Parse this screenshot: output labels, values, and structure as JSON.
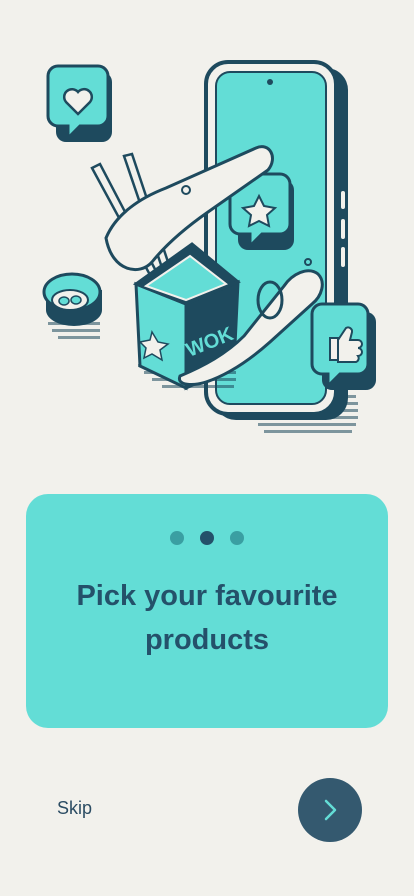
{
  "onboarding": {
    "title": "Pick your favourite products",
    "pagination": {
      "total": 3,
      "current_index": 1
    },
    "skip_label": "Skip",
    "next_button": {
      "icon": "chevron-right-icon"
    },
    "illustration": {
      "box_label": "WOK",
      "icons": [
        "heart-icon",
        "star-icon",
        "thumbs-up-icon",
        "smartphone-icon",
        "sushi-roll-icon",
        "wok-box-icon",
        "chopsticks-icon"
      ]
    }
  },
  "colors": {
    "background": "#f2f1ec",
    "card": "#63ddd6",
    "primary": "#24516a",
    "dot_inactive": "#3a9fa2",
    "button": "#34596f"
  }
}
